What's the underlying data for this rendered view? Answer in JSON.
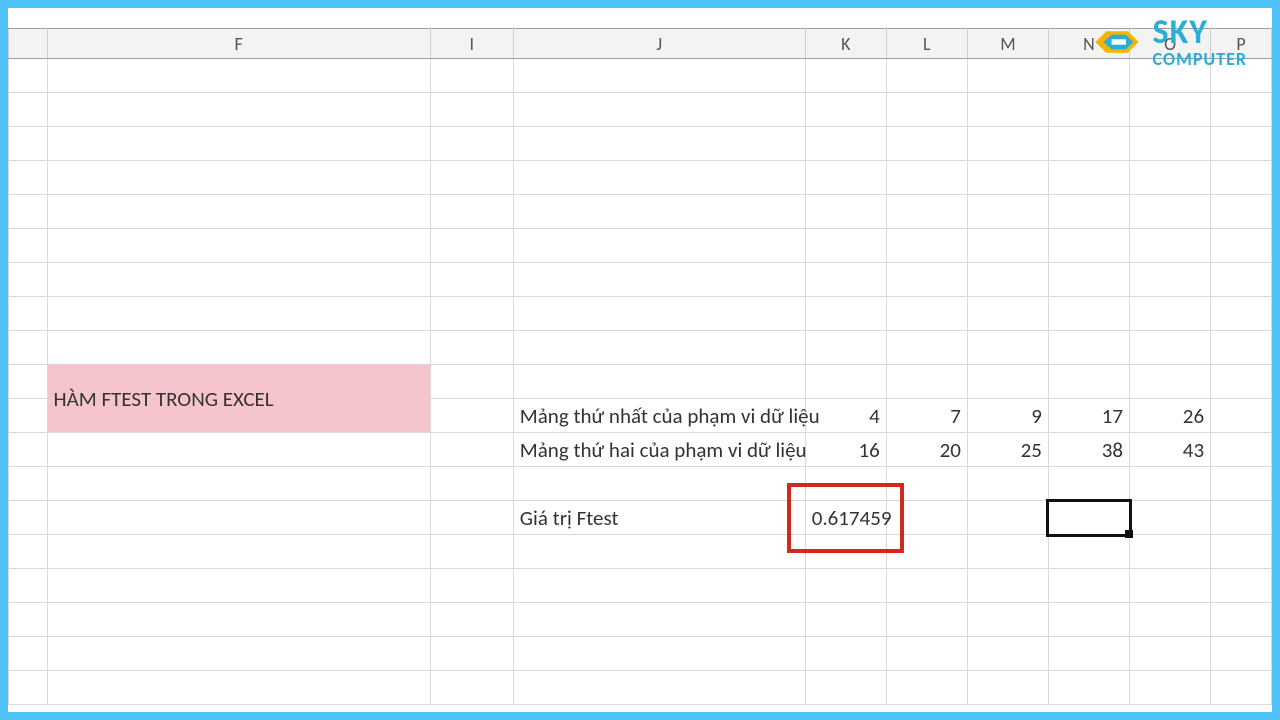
{
  "columns": {
    "rowhdr": "",
    "F": "F",
    "I": "I",
    "J": "J",
    "K": "K",
    "L": "L",
    "M": "M",
    "N": "N",
    "O": "O",
    "P": "P"
  },
  "title": "HÀM FTEST TRONG EXCEL",
  "labels": {
    "array1": "Mảng thứ nhất của phạm vi dữ liệu",
    "array2": "Mảng thứ hai của phạm vi dữ liệu",
    "ftest_label": "Giá trị Ftest"
  },
  "array1": {
    "K": "4",
    "L": "7",
    "M": "9",
    "N": "17",
    "O": "26"
  },
  "array2": {
    "K": "16",
    "L": "20",
    "M": "25",
    "N": "38",
    "O": "43"
  },
  "ftest_value": "0.617459",
  "logo": {
    "sky": "SKY",
    "computer": "COMPUTER"
  }
}
